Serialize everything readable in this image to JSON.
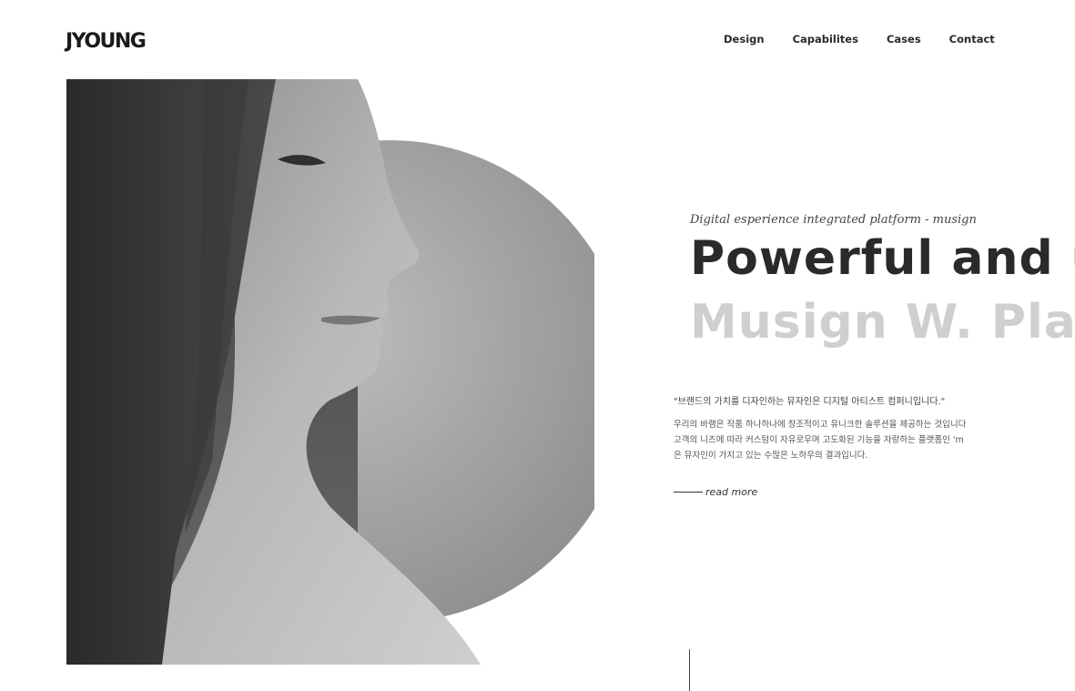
{
  "header": {
    "logo": "JYOUNG",
    "nav": [
      "Design",
      "Capabilites",
      "Cases",
      "Contact"
    ]
  },
  "hero": {
    "tagline": "Digital esperience integrated platform - musign",
    "headline": "Powerful and u",
    "subhead": "Musign W. Pla",
    "quote": "\"브랜드의 가치를 디자인하는 뮤자인은 디지털 아티스트 컴퍼니입니다.\"",
    "body": [
      "우리의 바램은 작품 하나하나에 창조적이고 유니크한 솔루션을 제공하는 것입니다",
      "고객의 니즈에 따라 커스텀이 자유로우며 고도화된 기능을 자랑하는 플랫폼인 'm",
      "은 뮤자인이 가지고 있는 수많은 노하우의 결과입니다."
    ],
    "read_more": "read more"
  },
  "colors": {
    "headline": "#2a2a2a",
    "subhead": "#cfcfcf",
    "circle": "#9a9a9a"
  }
}
